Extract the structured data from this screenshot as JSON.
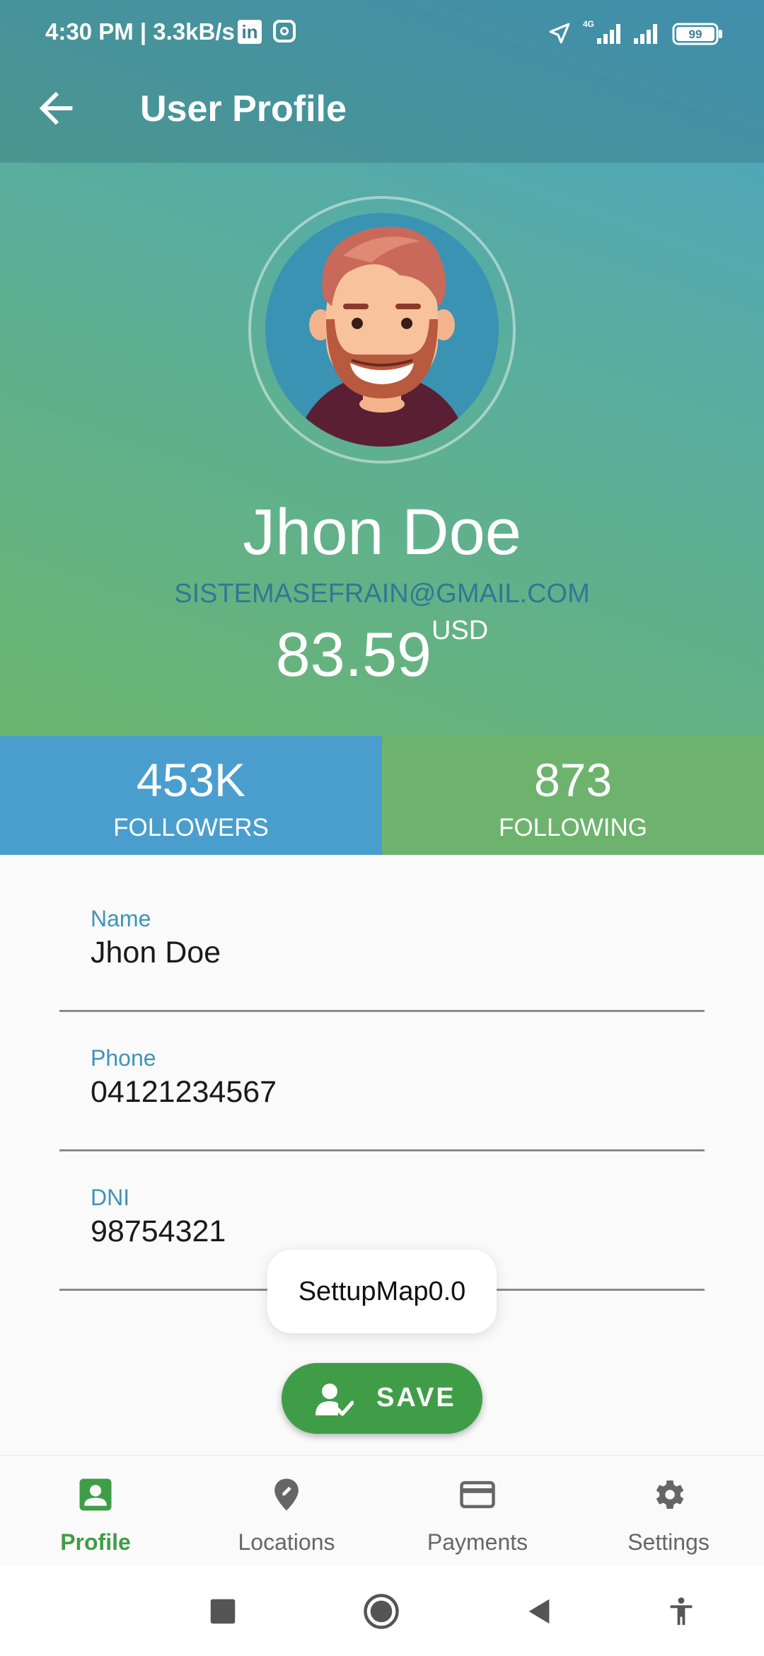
{
  "status_bar": {
    "time": "4:30 PM | 3.3kB/s",
    "network_label": "4G",
    "battery": "99",
    "icons": [
      "linkedin-icon",
      "instagram-icon",
      "location-arrow-icon",
      "signal-4g-icon",
      "signal-icon",
      "battery-icon"
    ]
  },
  "appbar": {
    "title": "User Profile",
    "back_icon": "arrow-back-icon"
  },
  "profile": {
    "name": "Jhon Doe",
    "email": "SISTEMASEFRAIN@GMAIL.COM",
    "balance": "83.59",
    "currency": "USD"
  },
  "stats": {
    "followers": {
      "value": "453K",
      "label": "FOLLOWERS"
    },
    "following": {
      "value": "873",
      "label": "FOLLOWING"
    }
  },
  "form": {
    "name": {
      "label": "Name",
      "value": "Jhon Doe"
    },
    "phone": {
      "label": "Phone",
      "value": "04121234567"
    },
    "dni": {
      "label": "DNI",
      "value": "98754321"
    }
  },
  "toast": {
    "text": "SettupMap0.0"
  },
  "save_button": {
    "label": "SAVE",
    "icon": "person-check-icon"
  },
  "bottom_nav": {
    "items": [
      {
        "label": "Profile",
        "icon": "account-box-icon",
        "active": true
      },
      {
        "label": "Locations",
        "icon": "location-pin-icon",
        "active": false
      },
      {
        "label": "Payments",
        "icon": "credit-card-icon",
        "active": false
      },
      {
        "label": "Settings",
        "icon": "gear-icon",
        "active": false
      }
    ]
  },
  "colors": {
    "accent_green": "#3f9d48",
    "followers_blue": "#4a9ecd",
    "following_green": "#6db36d",
    "label_blue": "#3f94b7"
  }
}
